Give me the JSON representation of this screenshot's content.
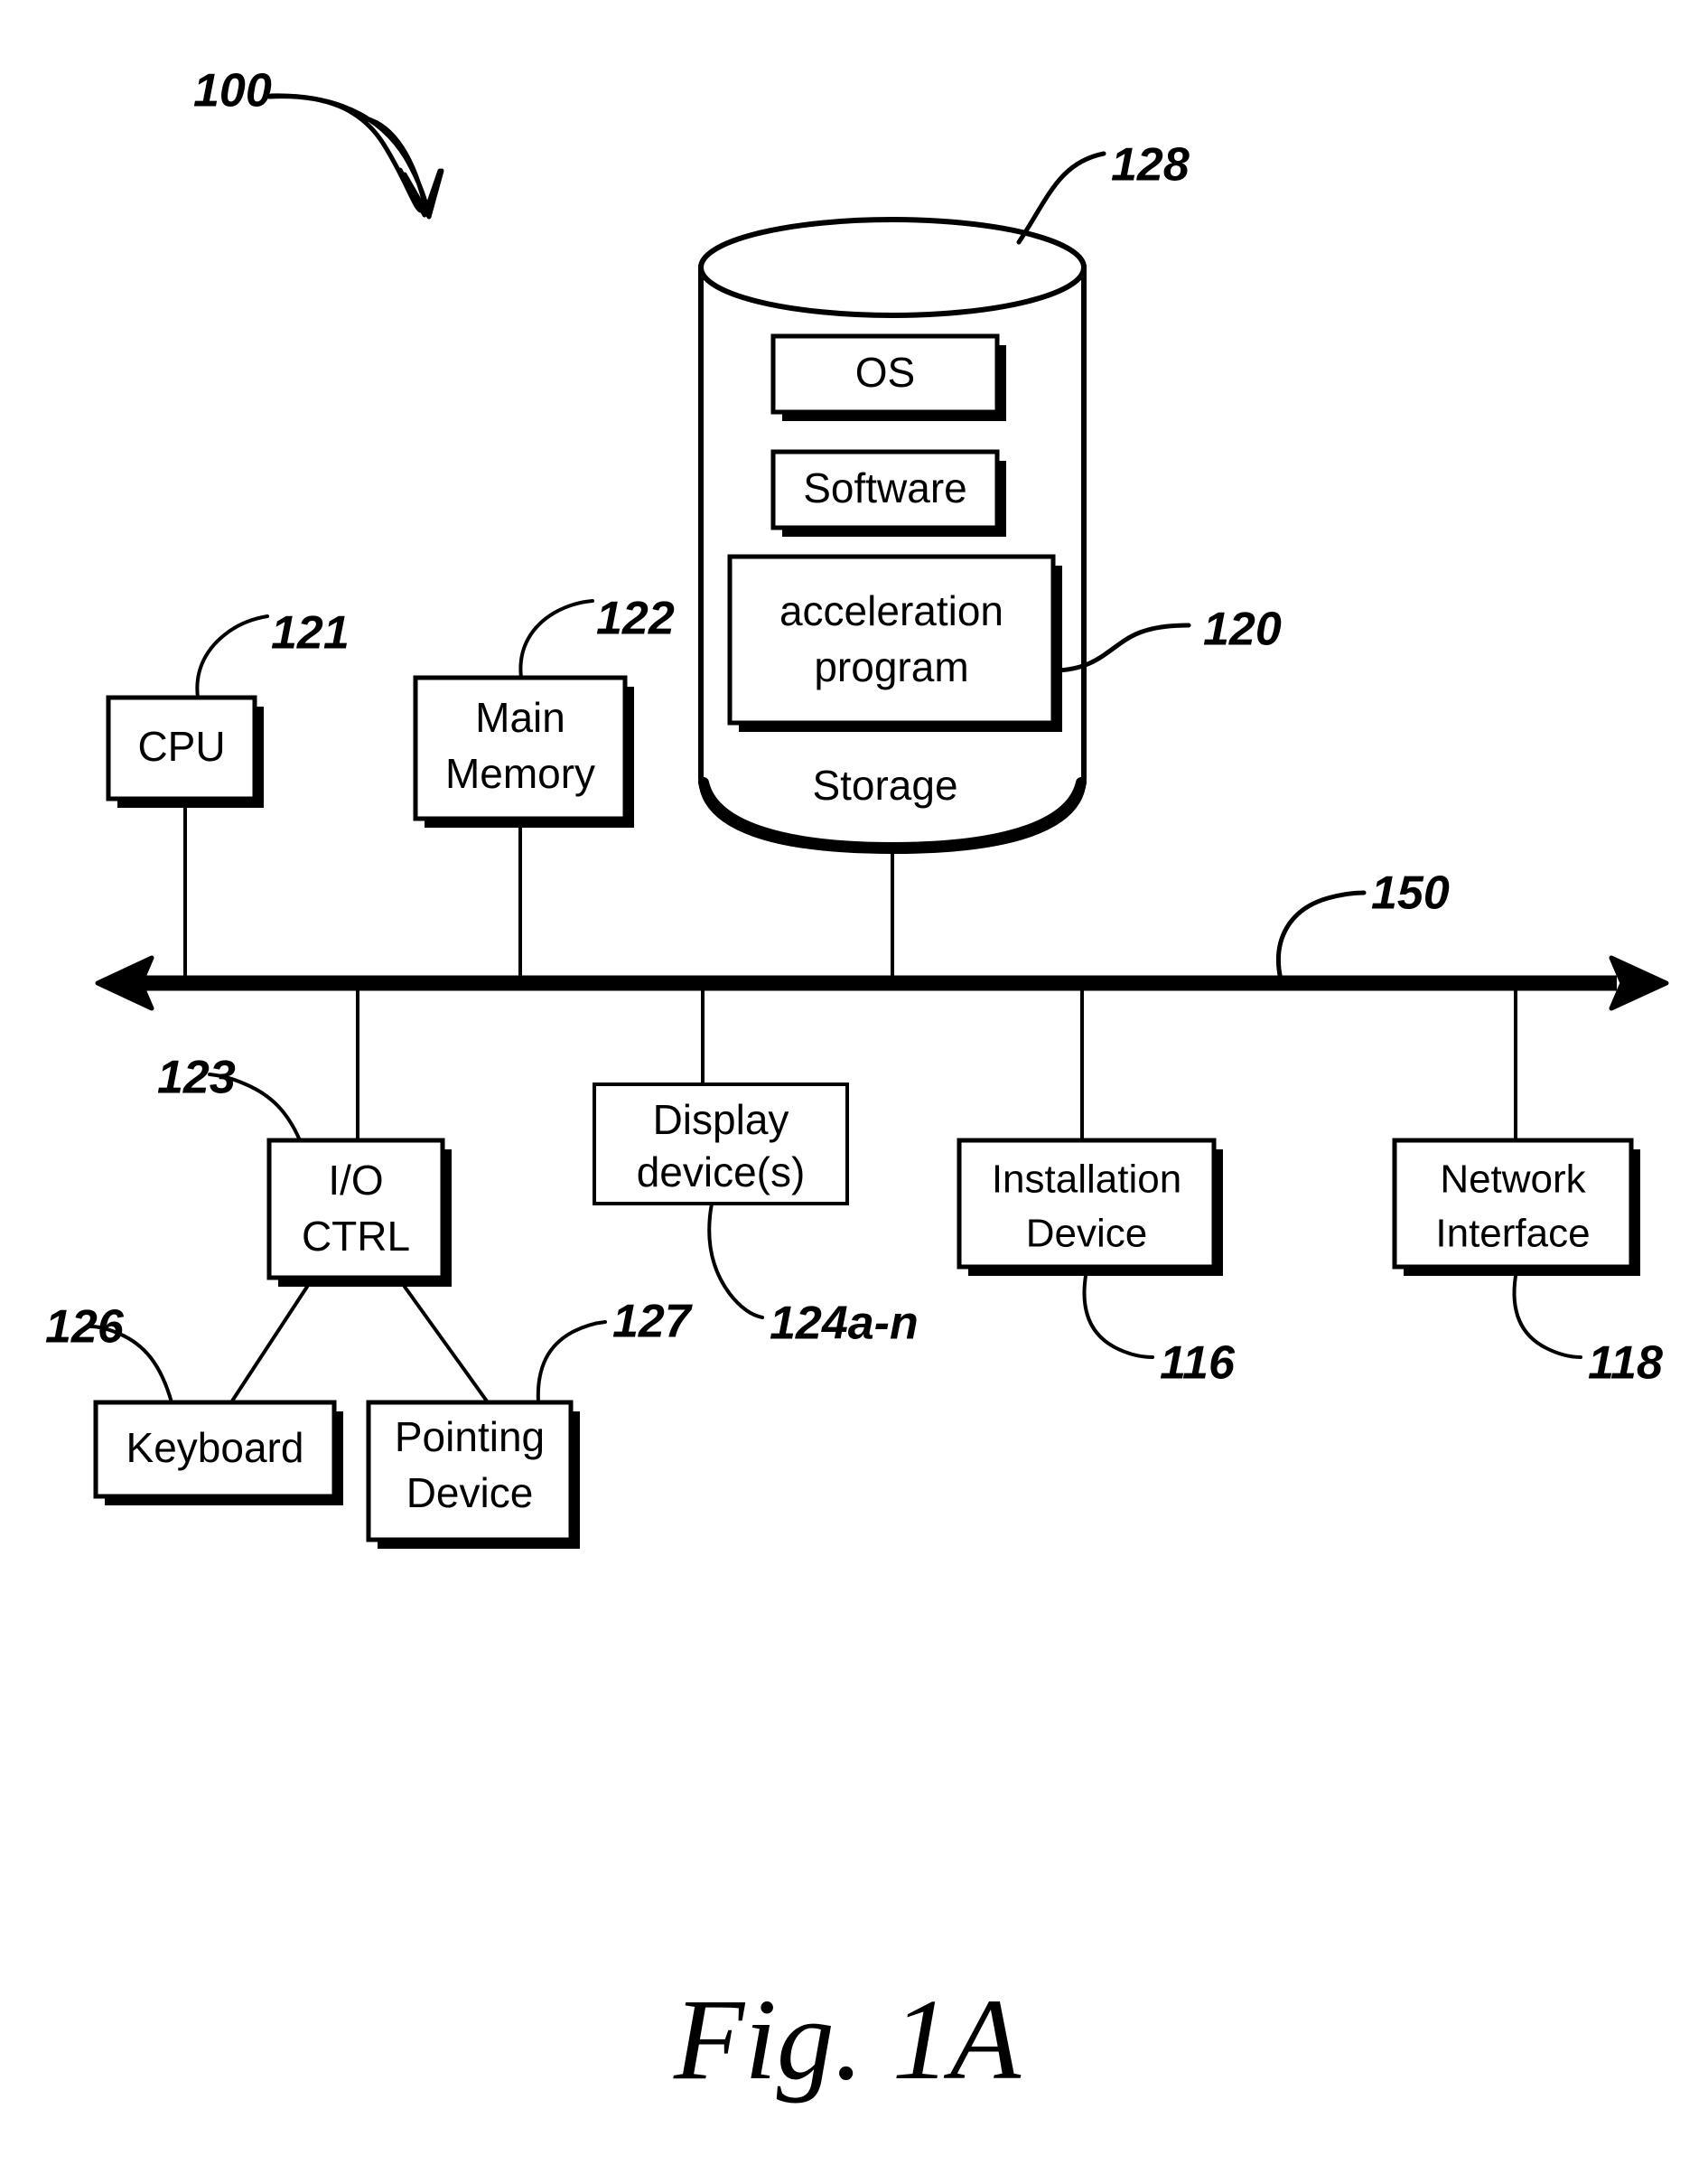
{
  "figure": {
    "caption": "Fig. 1A",
    "system_ref": "100"
  },
  "storage": {
    "cylinder_label": "Storage",
    "cylinder_ref": "128",
    "items": [
      {
        "label": "OS",
        "ref": ""
      },
      {
        "label": "Software",
        "ref": ""
      },
      {
        "label_line1": "acceleration",
        "label_line2": "program",
        "ref": "120"
      }
    ]
  },
  "bus": {
    "label": "150"
  },
  "components": [
    {
      "id": "cpu",
      "label_line1": "CPU",
      "label_line2": "",
      "ref": "121"
    },
    {
      "id": "main-memory",
      "label_line1": "Main",
      "label_line2": "Memory",
      "ref": "122"
    },
    {
      "id": "io-ctrl",
      "label_line1": "I/O",
      "label_line2": "CTRL",
      "ref": "123"
    },
    {
      "id": "display",
      "label_line1": "Display",
      "label_line2": "device(s)",
      "ref": "124a-n"
    },
    {
      "id": "installation",
      "label_line1": "Installation",
      "label_line2": "Device",
      "ref": "116"
    },
    {
      "id": "network",
      "label_line1": "Network",
      "label_line2": "Interface",
      "ref": "118"
    },
    {
      "id": "keyboard",
      "label_line1": "Keyboard",
      "label_line2": "",
      "ref": "126"
    },
    {
      "id": "pointing",
      "label_line1": "Pointing",
      "label_line2": "Device",
      "ref": "127"
    }
  ],
  "colors": {
    "ink": "#000000",
    "paper": "#ffffff"
  }
}
